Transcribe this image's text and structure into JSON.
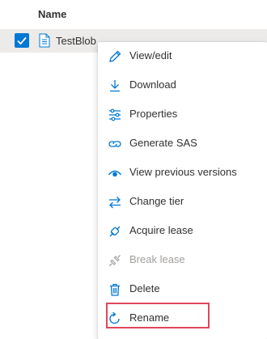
{
  "header": {
    "name_label": "Name"
  },
  "row": {
    "file_name": "TestBlob",
    "checked": true
  },
  "menu": {
    "items": [
      {
        "label": "View/edit",
        "icon": "pencil-icon",
        "enabled": true
      },
      {
        "label": "Download",
        "icon": "download-icon",
        "enabled": true
      },
      {
        "label": "Properties",
        "icon": "properties-icon",
        "enabled": true
      },
      {
        "label": "Generate SAS",
        "icon": "link-icon",
        "enabled": true
      },
      {
        "label": "View previous versions",
        "icon": "eye-icon",
        "enabled": true
      },
      {
        "label": "Change tier",
        "icon": "swap-arrows-icon",
        "enabled": true
      },
      {
        "label": "Acquire lease",
        "icon": "plug-icon",
        "enabled": true
      },
      {
        "label": "Break lease",
        "icon": "broken-plug-icon",
        "enabled": false
      },
      {
        "label": "Delete",
        "icon": "trash-icon",
        "enabled": true
      },
      {
        "label": "Rename",
        "icon": "rename-icon",
        "enabled": true,
        "highlighted": true
      }
    ]
  },
  "colors": {
    "accent": "#0078d4",
    "highlight_border": "#e0475a",
    "disabled_text": "#a19f9d",
    "row_selected_bg": "#edebe9"
  }
}
